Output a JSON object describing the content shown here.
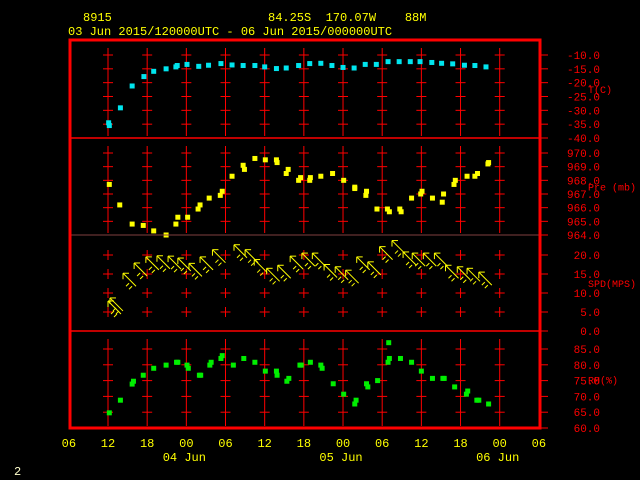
{
  "header": {
    "station": "8915",
    "location": "84.25S  170.07W    88M",
    "period": "03 Jun 2015/120000UTC - 06 Jun 2015/000000UTC"
  },
  "footer": {
    "page": "2"
  },
  "colors": {
    "frame": "#ff0000",
    "temp": "#00e5ee",
    "pressure": "#ffff00",
    "wind": "#ffff00",
    "rh": "#00ee00",
    "label": "#ffff00"
  },
  "chart_data": {
    "type": "scatter",
    "title": "8915  84.25S 170.07W 88M",
    "x_unit": "hours since 03 Jun 2015 12 UTC",
    "x_ticks": [
      {
        "h": -6,
        "label": "06"
      },
      {
        "h": 0,
        "label": "12"
      },
      {
        "h": 6,
        "label": "18"
      },
      {
        "h": 12,
        "label": "00"
      },
      {
        "h": 18,
        "label": "06"
      },
      {
        "h": 24,
        "label": "12"
      },
      {
        "h": 30,
        "label": "18"
      },
      {
        "h": 36,
        "label": "00"
      },
      {
        "h": 42,
        "label": "06"
      },
      {
        "h": 48,
        "label": "12"
      },
      {
        "h": 54,
        "label": "18"
      },
      {
        "h": 60,
        "label": "00"
      },
      {
        "h": 66,
        "label": "06"
      }
    ],
    "date_labels": [
      {
        "h": 12,
        "label": "04 Jun"
      },
      {
        "h": 36,
        "label": "05 Jun"
      },
      {
        "h": 60,
        "label": "06 Jun"
      }
    ],
    "panels": [
      {
        "name": "temperature",
        "ylabel": "T(C)",
        "ylim": [
          -40,
          -10
        ],
        "yticks": [
          "-10.0",
          "-15.0",
          "-20.0",
          "-25.0",
          "-30.0",
          "-35.0",
          "-40.0"
        ],
        "points": [
          [
            0.1,
            -34.5
          ],
          [
            0.2,
            -35.5
          ],
          [
            1.9,
            -29.1
          ],
          [
            3.7,
            -21.2
          ],
          [
            5.5,
            -17.8
          ],
          [
            7,
            -15.9
          ],
          [
            8.9,
            -15
          ],
          [
            10.4,
            -14.3
          ],
          [
            10.6,
            -13.8
          ],
          [
            12.1,
            -13.4
          ],
          [
            13.9,
            -14.1
          ],
          [
            15.4,
            -13.7
          ],
          [
            17.3,
            -13.1
          ],
          [
            19,
            -13.6
          ],
          [
            20.7,
            -13.8
          ],
          [
            22.5,
            -13.8
          ],
          [
            24,
            -14.3
          ],
          [
            25.8,
            -14.9
          ],
          [
            27.3,
            -14.7
          ],
          [
            29.2,
            -13.8
          ],
          [
            30.9,
            -13.1
          ],
          [
            32.6,
            -13
          ],
          [
            34.3,
            -13.8
          ],
          [
            36,
            -14.5
          ],
          [
            37.7,
            -14.7
          ],
          [
            39.4,
            -13.4
          ],
          [
            41.1,
            -13.4
          ],
          [
            42.9,
            -12.4
          ],
          [
            44.6,
            -12.4
          ],
          [
            46.3,
            -12.4
          ],
          [
            47.8,
            -12.4
          ],
          [
            49.6,
            -12.7
          ],
          [
            51.1,
            -13
          ],
          [
            52.8,
            -13.2
          ],
          [
            54.6,
            -13.7
          ],
          [
            56.2,
            -13.8
          ],
          [
            57.9,
            -14.3
          ]
        ]
      },
      {
        "name": "pressure",
        "ylabel": "Pre (mb)",
        "ylim": [
          964,
          970
        ],
        "yticks": [
          "970.0",
          "969.0",
          "968.0",
          "967.0",
          "966.0",
          "965.0",
          "964.0"
        ],
        "points": [
          [
            0.2,
            967.7
          ],
          [
            1.8,
            966.2
          ],
          [
            3.7,
            964.8
          ],
          [
            5.4,
            964.7
          ],
          [
            7,
            964.3
          ],
          [
            8.9,
            964
          ],
          [
            10.4,
            964.8
          ],
          [
            10.7,
            965.3
          ],
          [
            12.2,
            965.3
          ],
          [
            13.8,
            965.9
          ],
          [
            14.1,
            966.2
          ],
          [
            15.5,
            966.7
          ],
          [
            17.2,
            966.9
          ],
          [
            17.5,
            967.2
          ],
          [
            19,
            968.3
          ],
          [
            20.7,
            969.1
          ],
          [
            20.9,
            968.8
          ],
          [
            22.5,
            969.6
          ],
          [
            24.1,
            969.5
          ],
          [
            25.8,
            969.5
          ],
          [
            25.9,
            969.3
          ],
          [
            27.3,
            968.5
          ],
          [
            27.6,
            968.8
          ],
          [
            29.2,
            968
          ],
          [
            29.5,
            968.2
          ],
          [
            30.9,
            968
          ],
          [
            31,
            968.2
          ],
          [
            32.6,
            968.3
          ],
          [
            34.4,
            968.5
          ],
          [
            36.1,
            968
          ],
          [
            37.8,
            967.5
          ],
          [
            37.8,
            967.4
          ],
          [
            39.5,
            966.9
          ],
          [
            39.6,
            967.2
          ],
          [
            41.2,
            965.9
          ],
          [
            42.8,
            965.9
          ],
          [
            43.1,
            965.7
          ],
          [
            44.7,
            965.9
          ],
          [
            44.9,
            965.7
          ],
          [
            46.5,
            966.7
          ],
          [
            47.9,
            967
          ],
          [
            48.1,
            967.2
          ],
          [
            49.7,
            966.7
          ],
          [
            51.2,
            966.4
          ],
          [
            51.4,
            967
          ],
          [
            53,
            967.7
          ],
          [
            53.2,
            968
          ],
          [
            55,
            968.3
          ],
          [
            56.2,
            968.3
          ],
          [
            56.6,
            968.5
          ],
          [
            58.2,
            969.2
          ],
          [
            58.3,
            969.3
          ]
        ]
      },
      {
        "name": "wind",
        "ylabel": "SPD(MPS)",
        "ylim": [
          0,
          25
        ],
        "yticks": [
          "20.0",
          "15.0",
          "10.0",
          "5.0",
          "0.0"
        ],
        "points": [
          [
            0,
            7.9
          ],
          [
            0.3,
            8.7
          ],
          [
            2.3,
            15.2
          ],
          [
            4,
            17.9
          ],
          [
            5.8,
            19.5
          ],
          [
            7.5,
            19.8
          ],
          [
            9.2,
            19.7
          ],
          [
            10.7,
            19.2
          ],
          [
            12.4,
            17.8
          ],
          [
            14.1,
            19.5
          ],
          [
            16,
            21.4
          ],
          [
            19.3,
            22.7
          ],
          [
            21,
            21.4
          ],
          [
            22.4,
            18.8
          ],
          [
            24.3,
            16.5
          ],
          [
            26,
            17.3
          ],
          [
            27.9,
            19.7
          ],
          [
            29.7,
            20.5
          ],
          [
            31.3,
            20.5
          ],
          [
            33.1,
            17.5
          ],
          [
            34.8,
            16.9
          ],
          [
            36.4,
            16
          ],
          [
            38.1,
            19.5
          ],
          [
            39.8,
            18.2
          ],
          [
            41.6,
            22.2
          ],
          [
            43.5,
            23.8
          ],
          [
            45.2,
            20.8
          ],
          [
            46.6,
            20.5
          ],
          [
            48.3,
            20.5
          ],
          [
            50,
            20.5
          ],
          [
            51.7,
            17.3
          ],
          [
            53.5,
            16.9
          ],
          [
            55,
            16.5
          ],
          [
            56.8,
            15.5
          ]
        ]
      },
      {
        "name": "rh",
        "ylabel": "RH(%)",
        "ylim": [
          60,
          90
        ],
        "yticks": [
          "85.0",
          "80.0",
          "75.0",
          "70.0",
          "65.0",
          "60.0"
        ],
        "points": [
          [
            0.2,
            64.8
          ],
          [
            1.9,
            68.8
          ],
          [
            3.7,
            73.9
          ],
          [
            3.9,
            74.8
          ],
          [
            5.4,
            76.7
          ],
          [
            7,
            78.9
          ],
          [
            8.9,
            79.9
          ],
          [
            10.5,
            80.8
          ],
          [
            10.7,
            80.8
          ],
          [
            12.1,
            79.9
          ],
          [
            12.3,
            78.9
          ],
          [
            14,
            76.7
          ],
          [
            14.2,
            76.7
          ],
          [
            15.6,
            79.9
          ],
          [
            15.8,
            80.8
          ],
          [
            17.3,
            82
          ],
          [
            17.5,
            82.9
          ],
          [
            19.2,
            79.9
          ],
          [
            20.8,
            82
          ],
          [
            22.5,
            80.8
          ],
          [
            24.1,
            78
          ],
          [
            25.8,
            78
          ],
          [
            25.9,
            76.7
          ],
          [
            27.4,
            74.8
          ],
          [
            27.7,
            75.7
          ],
          [
            29.4,
            79.9
          ],
          [
            29.6,
            79.9
          ],
          [
            31,
            80.8
          ],
          [
            32.6,
            79.9
          ],
          [
            32.8,
            78.9
          ],
          [
            34.5,
            74
          ],
          [
            36.1,
            70.7
          ],
          [
            37.8,
            67.6
          ],
          [
            38,
            68.8
          ],
          [
            39.6,
            74
          ],
          [
            39.8,
            73
          ],
          [
            41.3,
            75
          ],
          [
            43,
            87
          ],
          [
            42.9,
            80.8
          ],
          [
            43.1,
            82
          ],
          [
            44.8,
            82
          ],
          [
            46.5,
            80.8
          ],
          [
            48,
            78
          ],
          [
            49.7,
            75.7
          ],
          [
            51.3,
            75.7
          ],
          [
            51.5,
            75.7
          ],
          [
            53.1,
            73
          ],
          [
            54.9,
            70.7
          ],
          [
            55.1,
            71.7
          ],
          [
            56.5,
            68.8
          ],
          [
            56.8,
            68.8
          ],
          [
            58.3,
            67.6
          ]
        ]
      }
    ]
  }
}
